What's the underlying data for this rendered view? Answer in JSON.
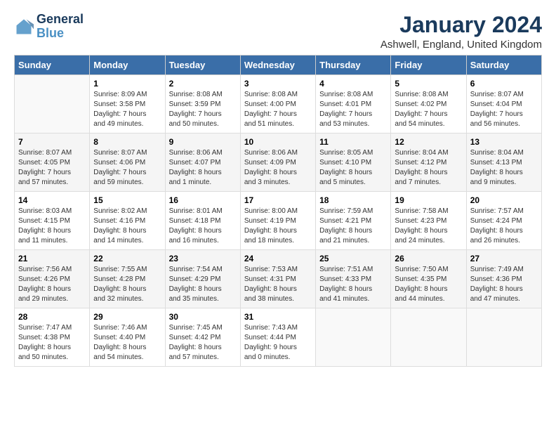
{
  "logo": {
    "line1": "General",
    "line2": "Blue"
  },
  "title": "January 2024",
  "subtitle": "Ashwell, England, United Kingdom",
  "weekdays": [
    "Sunday",
    "Monday",
    "Tuesday",
    "Wednesday",
    "Thursday",
    "Friday",
    "Saturday"
  ],
  "weeks": [
    [
      {
        "day": "",
        "info": ""
      },
      {
        "day": "1",
        "info": "Sunrise: 8:09 AM\nSunset: 3:58 PM\nDaylight: 7 hours\nand 49 minutes."
      },
      {
        "day": "2",
        "info": "Sunrise: 8:08 AM\nSunset: 3:59 PM\nDaylight: 7 hours\nand 50 minutes."
      },
      {
        "day": "3",
        "info": "Sunrise: 8:08 AM\nSunset: 4:00 PM\nDaylight: 7 hours\nand 51 minutes."
      },
      {
        "day": "4",
        "info": "Sunrise: 8:08 AM\nSunset: 4:01 PM\nDaylight: 7 hours\nand 53 minutes."
      },
      {
        "day": "5",
        "info": "Sunrise: 8:08 AM\nSunset: 4:02 PM\nDaylight: 7 hours\nand 54 minutes."
      },
      {
        "day": "6",
        "info": "Sunrise: 8:07 AM\nSunset: 4:04 PM\nDaylight: 7 hours\nand 56 minutes."
      }
    ],
    [
      {
        "day": "7",
        "info": "Sunrise: 8:07 AM\nSunset: 4:05 PM\nDaylight: 7 hours\nand 57 minutes."
      },
      {
        "day": "8",
        "info": "Sunrise: 8:07 AM\nSunset: 4:06 PM\nDaylight: 7 hours\nand 59 minutes."
      },
      {
        "day": "9",
        "info": "Sunrise: 8:06 AM\nSunset: 4:07 PM\nDaylight: 8 hours\nand 1 minute."
      },
      {
        "day": "10",
        "info": "Sunrise: 8:06 AM\nSunset: 4:09 PM\nDaylight: 8 hours\nand 3 minutes."
      },
      {
        "day": "11",
        "info": "Sunrise: 8:05 AM\nSunset: 4:10 PM\nDaylight: 8 hours\nand 5 minutes."
      },
      {
        "day": "12",
        "info": "Sunrise: 8:04 AM\nSunset: 4:12 PM\nDaylight: 8 hours\nand 7 minutes."
      },
      {
        "day": "13",
        "info": "Sunrise: 8:04 AM\nSunset: 4:13 PM\nDaylight: 8 hours\nand 9 minutes."
      }
    ],
    [
      {
        "day": "14",
        "info": "Sunrise: 8:03 AM\nSunset: 4:15 PM\nDaylight: 8 hours\nand 11 minutes."
      },
      {
        "day": "15",
        "info": "Sunrise: 8:02 AM\nSunset: 4:16 PM\nDaylight: 8 hours\nand 14 minutes."
      },
      {
        "day": "16",
        "info": "Sunrise: 8:01 AM\nSunset: 4:18 PM\nDaylight: 8 hours\nand 16 minutes."
      },
      {
        "day": "17",
        "info": "Sunrise: 8:00 AM\nSunset: 4:19 PM\nDaylight: 8 hours\nand 18 minutes."
      },
      {
        "day": "18",
        "info": "Sunrise: 7:59 AM\nSunset: 4:21 PM\nDaylight: 8 hours\nand 21 minutes."
      },
      {
        "day": "19",
        "info": "Sunrise: 7:58 AM\nSunset: 4:23 PM\nDaylight: 8 hours\nand 24 minutes."
      },
      {
        "day": "20",
        "info": "Sunrise: 7:57 AM\nSunset: 4:24 PM\nDaylight: 8 hours\nand 26 minutes."
      }
    ],
    [
      {
        "day": "21",
        "info": "Sunrise: 7:56 AM\nSunset: 4:26 PM\nDaylight: 8 hours\nand 29 minutes."
      },
      {
        "day": "22",
        "info": "Sunrise: 7:55 AM\nSunset: 4:28 PM\nDaylight: 8 hours\nand 32 minutes."
      },
      {
        "day": "23",
        "info": "Sunrise: 7:54 AM\nSunset: 4:29 PM\nDaylight: 8 hours\nand 35 minutes."
      },
      {
        "day": "24",
        "info": "Sunrise: 7:53 AM\nSunset: 4:31 PM\nDaylight: 8 hours\nand 38 minutes."
      },
      {
        "day": "25",
        "info": "Sunrise: 7:51 AM\nSunset: 4:33 PM\nDaylight: 8 hours\nand 41 minutes."
      },
      {
        "day": "26",
        "info": "Sunrise: 7:50 AM\nSunset: 4:35 PM\nDaylight: 8 hours\nand 44 minutes."
      },
      {
        "day": "27",
        "info": "Sunrise: 7:49 AM\nSunset: 4:36 PM\nDaylight: 8 hours\nand 47 minutes."
      }
    ],
    [
      {
        "day": "28",
        "info": "Sunrise: 7:47 AM\nSunset: 4:38 PM\nDaylight: 8 hours\nand 50 minutes."
      },
      {
        "day": "29",
        "info": "Sunrise: 7:46 AM\nSunset: 4:40 PM\nDaylight: 8 hours\nand 54 minutes."
      },
      {
        "day": "30",
        "info": "Sunrise: 7:45 AM\nSunset: 4:42 PM\nDaylight: 8 hours\nand 57 minutes."
      },
      {
        "day": "31",
        "info": "Sunrise: 7:43 AM\nSunset: 4:44 PM\nDaylight: 9 hours\nand 0 minutes."
      },
      {
        "day": "",
        "info": ""
      },
      {
        "day": "",
        "info": ""
      },
      {
        "day": "",
        "info": ""
      }
    ]
  ]
}
